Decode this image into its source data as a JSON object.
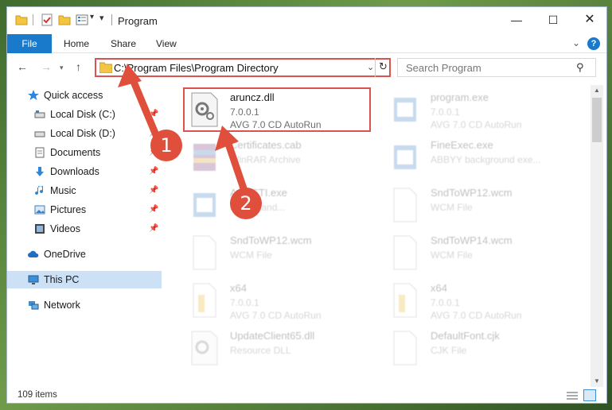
{
  "titlebar": {
    "title": "Program",
    "minimize": "—",
    "maximize": "☐",
    "close": "✕"
  },
  "ribbon": {
    "tabs": [
      "File",
      "Home",
      "Share",
      "View"
    ],
    "help": "?"
  },
  "nav": {
    "address": "C:\\Program Files\\Program Directory",
    "search_placeholder": "Search Program"
  },
  "sidebar": {
    "items": [
      {
        "label": "Quick access",
        "icon": "star-icon"
      },
      {
        "label": "Local Disk (C:)",
        "icon": "drive-icon"
      },
      {
        "label": "Local Disk (D:)",
        "icon": "drive-icon"
      },
      {
        "label": "Documents",
        "icon": "documents-icon"
      },
      {
        "label": "Downloads",
        "icon": "download-icon"
      },
      {
        "label": "Music",
        "icon": "music-icon"
      },
      {
        "label": "Pictures",
        "icon": "pictures-icon"
      },
      {
        "label": "Videos",
        "icon": "videos-icon"
      },
      {
        "label": "OneDrive",
        "icon": "cloud-icon"
      },
      {
        "label": "This PC",
        "icon": "computer-icon"
      },
      {
        "label": "Network",
        "icon": "network-icon"
      }
    ]
  },
  "files": [
    {
      "name": "aruncz.dll",
      "line2": "7.0.0.1",
      "line3": "AVG 7.0 CD AutoRun",
      "icon": "dll-gear-icon",
      "highlight": true
    },
    {
      "name": "program.exe",
      "line2": "7.0.0.1",
      "line3": "AVG 7.0 CD AutoRun",
      "icon": "exe-icon"
    },
    {
      "name": "Certificates.cab",
      "line2": "WinRAR Archive",
      "line3": "",
      "icon": "archive-icon"
    },
    {
      "name": "FineExec.exe",
      "line2": "ABBYY background exe...",
      "line3": "",
      "icon": "exe-icon"
    },
    {
      "name": "AvStSTI.exe",
      "line2": "event hand...",
      "line3": "",
      "icon": "exe-icon"
    },
    {
      "name": "SndToWP12.wcm",
      "line2": "WCM File",
      "line3": "",
      "icon": "file-icon"
    },
    {
      "name": "SndToWP12.wcm",
      "line2": "WCM File",
      "line3": "",
      "icon": "file-icon"
    },
    {
      "name": "SndToWP14.wcm",
      "line2": "WCM File",
      "line3": "",
      "icon": "file-icon"
    },
    {
      "name": "x64",
      "line2": "7.0.0.1",
      "line3": "AVG 7.0 CD AutoRun",
      "icon": "folder-file-icon"
    },
    {
      "name": "x64",
      "line2": "7.0.0.1",
      "line3": "AVG 7.0 CD AutoRun",
      "icon": "folder-file-icon"
    },
    {
      "name": "UpdateClient65.dll",
      "line2": "Resource DLL",
      "line3": "",
      "icon": "dll-gear-icon"
    },
    {
      "name": "DefaultFont.cjk",
      "line2": "CJK File",
      "line3": "",
      "icon": "file-icon"
    }
  ],
  "status": {
    "count": "109 items"
  },
  "annotations": {
    "badge1": "1",
    "badge2": "2",
    "color": "#e04e3c"
  }
}
